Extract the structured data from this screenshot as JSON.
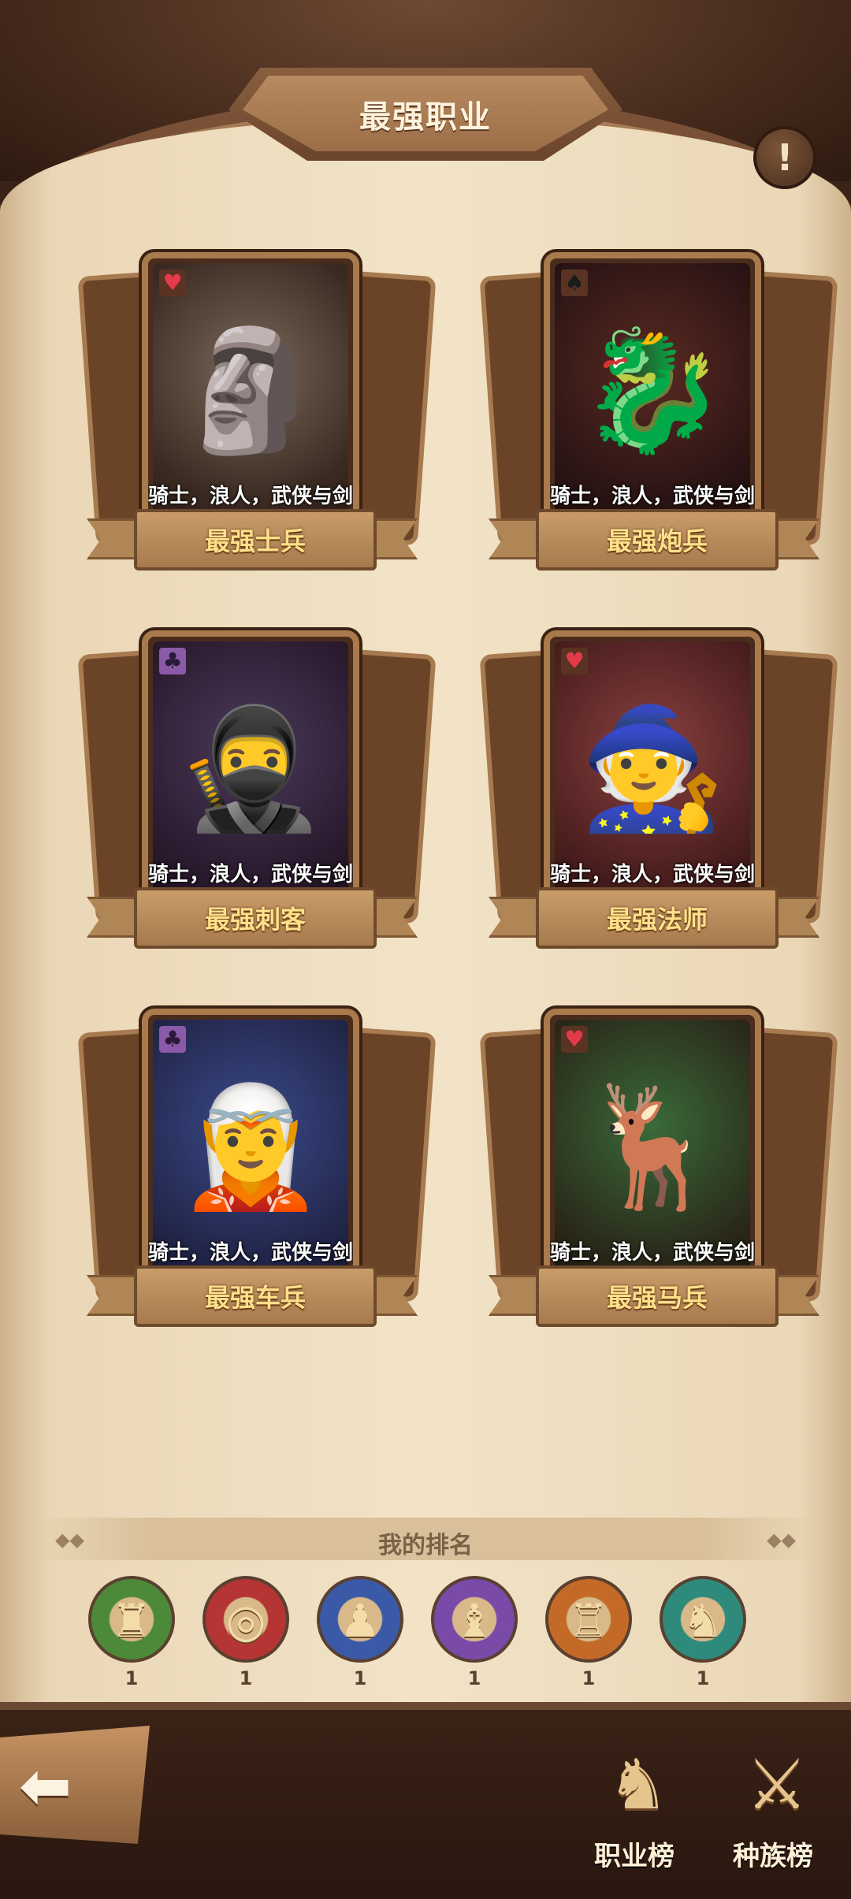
{
  "header": {
    "title": "最强职业",
    "info_icon": "!"
  },
  "cards": [
    {
      "label": "最强士兵",
      "subtitle": "骑士，浪人，武侠与剑客",
      "suit": "♥",
      "figure": "golem"
    },
    {
      "label": "最强炮兵",
      "subtitle": "骑士，浪人，武侠与剑客",
      "suit": "♠",
      "figure": "red-dragon"
    },
    {
      "label": "最强刺客",
      "subtitle": "骑士，浪人，武侠与剑客",
      "suit": "♣",
      "figure": "assassin"
    },
    {
      "label": "最强法师",
      "subtitle": "骑士，浪人，武侠与剑客",
      "suit": "♥",
      "figure": "christmas-mage"
    },
    {
      "label": "最强车兵",
      "subtitle": "骑士，浪人，武侠与剑客",
      "suit": "♣",
      "figure": "ice-dragon-girl"
    },
    {
      "label": "最强马兵",
      "subtitle": "骑士，浪人，武侠与剑客",
      "suit": "♥",
      "figure": "forest-centaur"
    }
  ],
  "ranking": {
    "title": "我的排名",
    "items": [
      {
        "icon": "knight-piece-icon",
        "glyph": "♜",
        "rank": "1",
        "ring": "#4c8a3a"
      },
      {
        "icon": "cannon-piece-icon",
        "glyph": "◎",
        "rank": "1",
        "ring": "#b53434"
      },
      {
        "icon": "assassin-piece-icon",
        "glyph": "♟",
        "rank": "1",
        "ring": "#3a5aa8"
      },
      {
        "icon": "mage-piece-icon",
        "glyph": "♝",
        "rank": "1",
        "ring": "#7a4aa8"
      },
      {
        "icon": "chariot-piece-icon",
        "glyph": "♖",
        "rank": "1",
        "ring": "#c46a28"
      },
      {
        "icon": "horse-piece-icon",
        "glyph": "♞",
        "rank": "1",
        "ring": "#2e8a7a"
      }
    ]
  },
  "nav": {
    "back_icon": "back-arrow-icon",
    "tabs": [
      {
        "label": "职业榜",
        "glyph": "♞"
      },
      {
        "label": "种族榜",
        "glyph": "⚔"
      }
    ]
  }
}
